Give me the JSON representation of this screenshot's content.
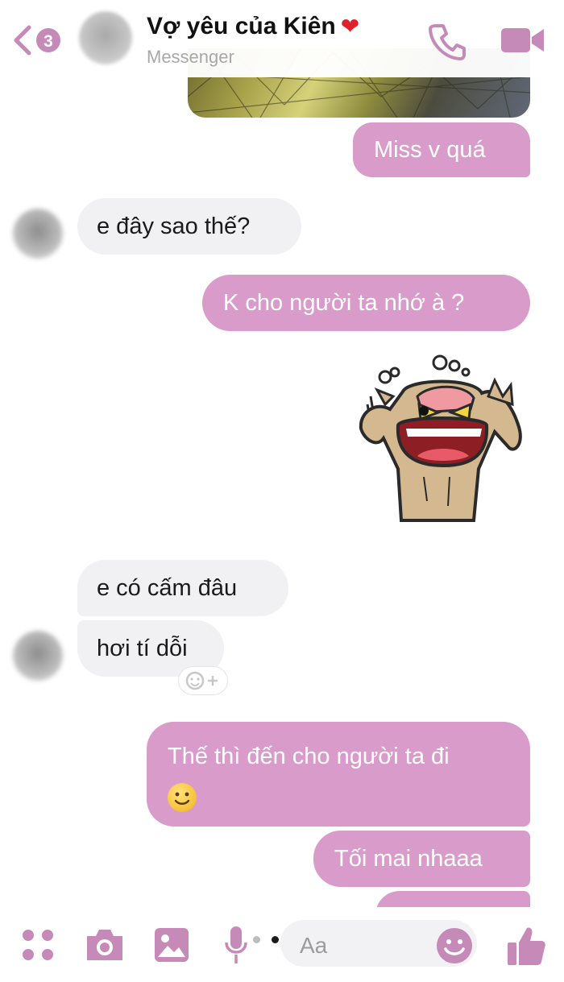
{
  "header": {
    "title": "Vợ yêu của Kiên",
    "title_emoji": "❤",
    "subtitle": "Messenger",
    "back_badge": "3"
  },
  "messages": [
    {
      "side": "out",
      "type": "image"
    },
    {
      "side": "out",
      "text": "Miss v quá"
    },
    {
      "side": "in",
      "text": "e đây sao thế?"
    },
    {
      "side": "out",
      "text": "K cho người ta nhớ à ?"
    },
    {
      "side": "out",
      "type": "sticker",
      "sticker": "angry-dog-sticker"
    },
    {
      "side": "in",
      "text": "e có cấm đâu"
    },
    {
      "side": "in",
      "text": "hơi tí dỗi"
    },
    {
      "side": "out",
      "text": "Thế thì đến cho người ta đi",
      "emoji": "smiling-face-emoji"
    },
    {
      "side": "out",
      "text": "Tối mai nhaaa"
    }
  ],
  "composer": {
    "placeholder": "Aa"
  },
  "colors": {
    "accent": "#c58ab8",
    "outgoing_bubble": "#d99cca",
    "incoming_bubble": "#f1f0f2"
  },
  "icons": [
    "back-icon",
    "phone-icon",
    "video-camera-icon",
    "apps-grid-icon",
    "camera-icon",
    "gallery-icon",
    "microphone-icon",
    "emoji-icon",
    "thumbs-up-icon",
    "add-reaction-icon"
  ]
}
